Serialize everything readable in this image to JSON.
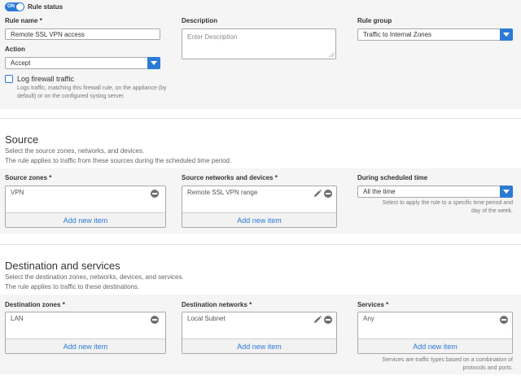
{
  "rule": {
    "status_on": "ON",
    "status_label": "Rule status",
    "name_label": "Rule name",
    "name_required": "*",
    "name_value": "Remote SSL VPN access",
    "description_label": "Description",
    "description_placeholder": "Enter Description",
    "group_label": "Rule group",
    "group_value": "Traffic to Internal Zones",
    "action_label": "Action",
    "action_value": "Accept",
    "log_label": "Log firewall traffic",
    "log_help_1": "Logs traffic, matching this firewall rule, on the appliance (by",
    "log_help_2": "default) or on the configured syslog server."
  },
  "source": {
    "title": "Source",
    "desc_1": "Select the source zones, networks, and devices.",
    "desc_2": "The rule applies to traffic from these sources during the scheduled time period.",
    "zones_label": "Source zones",
    "zones_required": "*",
    "zones_item": "VPN",
    "zones_add": "Add new item",
    "networks_label": "Source networks and devices",
    "networks_required": "*",
    "networks_item": "Remote SSL VPN range",
    "networks_add": "Add new item",
    "schedule_label": "During scheduled time",
    "schedule_value": "All the time",
    "schedule_help_1": "Select to apply the rule to a specific time period and",
    "schedule_help_2": "day of the week."
  },
  "destination": {
    "title": "Destination and services",
    "desc_1": "Select the destination zones, networks, devices, and services.",
    "desc_2": "The rule applies to traffic to these destinations.",
    "zones_label": "Destination zones",
    "zones_required": "*",
    "zones_item": "LAN",
    "zones_add": "Add new item",
    "networks_label": "Destination networks",
    "networks_required": "*",
    "networks_item": "Local Subnet",
    "networks_add": "Add new item",
    "services_label": "Services",
    "services_required": "*",
    "services_item": "Any",
    "services_add": "Add new item",
    "services_help_1": "Services are traffic types based on a combination of",
    "services_help_2": "protocols and ports."
  },
  "colors": {
    "accent": "#2a7ad6",
    "panel": "#f5f5f5"
  }
}
